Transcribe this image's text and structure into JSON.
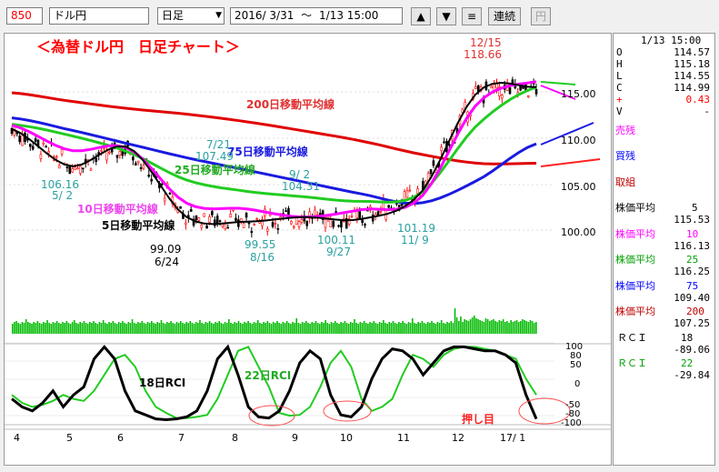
{
  "toolbar": {
    "code": "850",
    "name": "ドル円",
    "period": "日足",
    "range_start": "2016/ 3/31",
    "range_sep": "～",
    "range_end": "1/13 15:00",
    "continuous_label": "連続",
    "yen_label": "円",
    "up_arrow": "▲",
    "down_arrow": "▼",
    "menu_icon": "≡"
  },
  "chart": {
    "title": "＜為替ドル円　日足チャート＞",
    "price_axis": [
      "115.00",
      "110.00",
      "105.00",
      "100.00"
    ],
    "rci_axis": [
      "100",
      "80",
      "50",
      "0",
      "-50",
      "-80",
      "-100"
    ],
    "x_axis": [
      "4",
      "5",
      "6",
      "7",
      "8",
      "9",
      "10",
      "11",
      "12",
      "17/ 1"
    ],
    "annotations": {
      "high_date": "12/15",
      "high_price": "118.66",
      "ma200_label": "200日移動平均線",
      "ma75_label": "75日移動平均線",
      "ma25_label": "25日移動平均線",
      "ma10_label": "10日移動平均線",
      "ma5_label": "5日移動平均線",
      "p1_price": "106.16",
      "p1_date": "5/ 2",
      "p2_price": "107.49",
      "p2_date": "7/21",
      "p3_date": "9/ 2",
      "p3_price": "104.31",
      "p4_price": "99.09",
      "p4_date": "6/24",
      "p5_price": "99.55",
      "p5_date": "8/16",
      "p6_price": "100.11",
      "p6_date": "9/27",
      "p7_price": "101.19",
      "p7_date": "11/ 9",
      "rci18_label": "18日RCI",
      "rci22_label": "22日RCI",
      "oshime_label": "押し目"
    },
    "colors": {
      "candle_up": "#ff0000",
      "candle_down": "#000000",
      "ma5": "#000000",
      "ma10": "#ff00ff",
      "ma25": "#00c000",
      "ma75": "#0000ff",
      "ma200": "#e00000",
      "volume": "#00bb00",
      "title": "#ff0000",
      "annotation_cyan": "#2aa0a0"
    }
  },
  "chart_data": {
    "type": "line",
    "title": "＜為替ドル円　日足チャート＞",
    "x": [
      "4",
      "5",
      "6",
      "7",
      "8",
      "9",
      "10",
      "11",
      "12",
      "17/ 1"
    ],
    "ylim": [
      98,
      119
    ],
    "series": [
      {
        "name": "200日移動平均線",
        "values": [
          114.9,
          114.0,
          113.2,
          112.6,
          111.8,
          110.8,
          109.7,
          108.3,
          107.3,
          107.3
        ]
      },
      {
        "name": "75日移動平均線",
        "values": [
          112.2,
          110.9,
          109.4,
          107.9,
          106.6,
          105.3,
          104.0,
          103.0,
          105.5,
          109.4
        ]
      },
      {
        "name": "25日移動平均線",
        "values": [
          111.5,
          110.3,
          108.5,
          105.5,
          104.3,
          103.7,
          103.2,
          104.0,
          111.5,
          115.5
        ]
      },
      {
        "name": "10日移動平均線",
        "values": [
          111.4,
          108.7,
          108.9,
          103.0,
          102.4,
          101.5,
          102.3,
          103.5,
          113.8,
          116.1
        ]
      },
      {
        "name": "5日移動平均線",
        "values": [
          111.0,
          107.0,
          109.0,
          101.5,
          101.0,
          101.5,
          101.3,
          104.0,
          115.0,
          115.5
        ]
      }
    ]
  },
  "volume_data": [
    11,
    13,
    14,
    12,
    11,
    13,
    12,
    16,
    13,
    12,
    11,
    13,
    12,
    14,
    12,
    11,
    13,
    12,
    15,
    12,
    11,
    13,
    12,
    14,
    12,
    11,
    13,
    12,
    14,
    12,
    11,
    13,
    15,
    12,
    11,
    13,
    12,
    14,
    12,
    11,
    13,
    12,
    14,
    12,
    11,
    13,
    12,
    15,
    12,
    11,
    13,
    12,
    14,
    12,
    11,
    13,
    12,
    14,
    12,
    11,
    13,
    12,
    16,
    12,
    11,
    13,
    12,
    14,
    12,
    11,
    13,
    12,
    14,
    12,
    11,
    13,
    12,
    15,
    12,
    11,
    13,
    12,
    14,
    12,
    11,
    13,
    12,
    14,
    12,
    11,
    13,
    12,
    14,
    12,
    11,
    13,
    12,
    15,
    12,
    11,
    13,
    12,
    14,
    12,
    11,
    13,
    12,
    14,
    12,
    11,
    13,
    12,
    16,
    12,
    11,
    13,
    12,
    14,
    12,
    11,
    13,
    12,
    14,
    12,
    11,
    13,
    12,
    15,
    12,
    11,
    13,
    12,
    14,
    12,
    11,
    13,
    12,
    14,
    12,
    11,
    13,
    12,
    14,
    12,
    11,
    13,
    12,
    17,
    12,
    11,
    13,
    12,
    14,
    12,
    11,
    13,
    12,
    14,
    12,
    11,
    13,
    12,
    15,
    12,
    11,
    13,
    12,
    14,
    12,
    11,
    13,
    12,
    14,
    12,
    11,
    13,
    12,
    16,
    12,
    11,
    13,
    12,
    14,
    12,
    11,
    13,
    12,
    14,
    12,
    11,
    13,
    12,
    15,
    12,
    11,
    13,
    12,
    14,
    12,
    11,
    13,
    12,
    14,
    12,
    11,
    13,
    12,
    17,
    12,
    11,
    13,
    12,
    14,
    12,
    11,
    13,
    12,
    14,
    12,
    11,
    13,
    12,
    15,
    12,
    11,
    13,
    12,
    14,
    12,
    28,
    18,
    14,
    19,
    13,
    16,
    15,
    14,
    16,
    18,
    20,
    17,
    16,
    15,
    14,
    13,
    17,
    16,
    14,
    15,
    16,
    14,
    13,
    15,
    14,
    16,
    13,
    14,
    12,
    15,
    13,
    14,
    15,
    13,
    14,
    16,
    15,
    14,
    13,
    15,
    14,
    12,
    13
  ],
  "right_panel": {
    "datetime": "1/13 15:00",
    "ohlc": [
      {
        "k": "O",
        "v": "114.57",
        "color": "#000000"
      },
      {
        "k": "H",
        "v": "115.18",
        "color": "#000000"
      },
      {
        "k": "L",
        "v": "114.55",
        "color": "#000000"
      },
      {
        "k": "C",
        "v": "114.99",
        "color": "#000000"
      },
      {
        "k": "+",
        "v": "0.43",
        "color": "#ff0000"
      },
      {
        "k": "V",
        "v": "-",
        "color": "#000000"
      }
    ],
    "sell_label": "売残",
    "buy_label": "買残",
    "lend_label": "取組",
    "mas": [
      {
        "label": "株価平均",
        "period": "5",
        "value": "115.53",
        "color": "#000000"
      },
      {
        "label": "株価平均",
        "period": "10",
        "value": "116.13",
        "color": "#ff00ff"
      },
      {
        "label": "株価平均",
        "period": "25",
        "value": "116.25",
        "color": "#00a000"
      },
      {
        "label": "株価平均",
        "period": "75",
        "value": "109.40",
        "color": "#0000ff"
      },
      {
        "label": "株価平均",
        "period": "200",
        "value": "107.25",
        "color": "#c00000"
      }
    ],
    "rcis": [
      {
        "label": "ＲＣＩ",
        "period": "18",
        "value": "-89.06",
        "color": "#000000"
      },
      {
        "label": "ＲＣＩ",
        "period": "22",
        "value": "-29.84",
        "color": "#00a000"
      }
    ]
  }
}
